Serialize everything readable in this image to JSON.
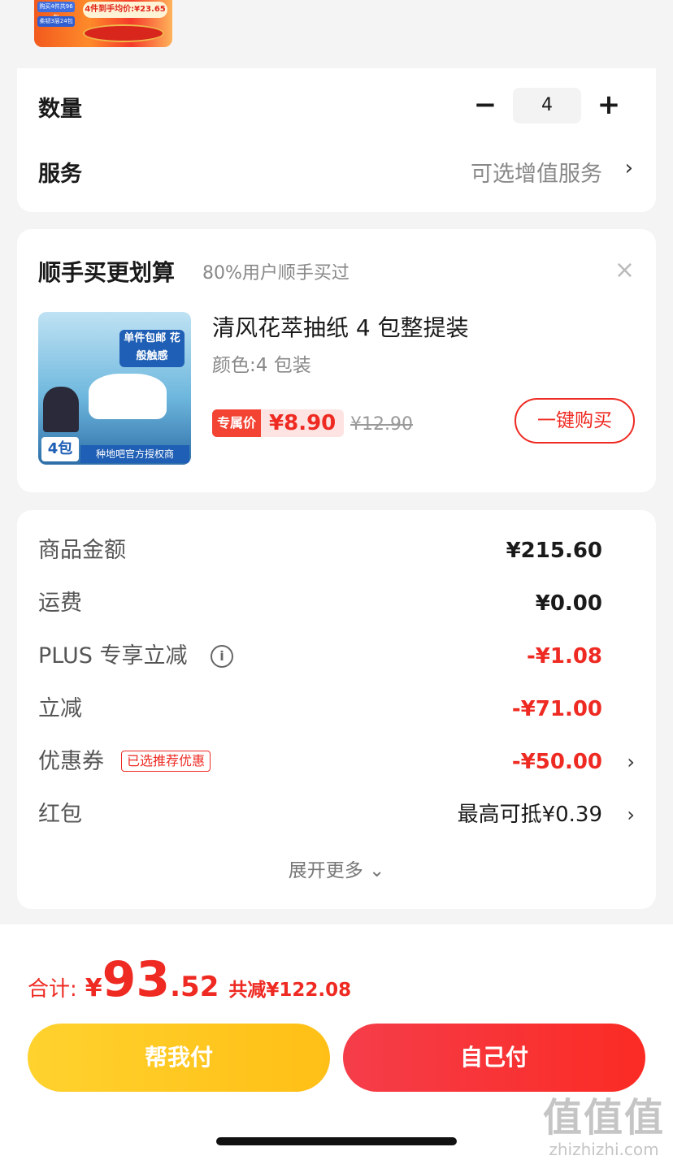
{
  "top_thumb": {
    "tag1": "购买4件共96包",
    "tag2": "柔韧3层24包",
    "promo": "4件到手均价:¥23.65"
  },
  "quantity": {
    "label": "数量",
    "value": "4",
    "minus": "−",
    "plus": "+"
  },
  "service": {
    "label": "服务",
    "value": "可选增值服务",
    "chevron": "›"
  },
  "addon": {
    "title": "顺手买更划算",
    "subtitle": "80%用户顺手买过",
    "close": "×",
    "product": {
      "image_badge": "单件包邮 花般触感",
      "image_count": "4包",
      "image_auth": "种地吧官方授权商",
      "name": "清风花萃抽纸 4 包整提装",
      "spec": "颜色:4 包装",
      "price_label": "专属价",
      "price": "¥8.90",
      "original_price": "¥12.90",
      "buy_label": "一键购买"
    }
  },
  "price_detail": {
    "rows": [
      {
        "label": "商品金额",
        "value": "¥215.60"
      },
      {
        "label": "运费",
        "value": "¥0.00"
      },
      {
        "label": "PLUS 专享立减",
        "value": "-¥1.08"
      },
      {
        "label": "立减",
        "value": "-¥71.00"
      },
      {
        "label": "优惠券",
        "tag": "已选推荐优惠",
        "value": "-¥50.00"
      },
      {
        "label": "红包",
        "value": "最高可抵¥0.39"
      }
    ],
    "info_icon": "i",
    "chevron": "›",
    "expand": "展开更多 ⌄"
  },
  "footer": {
    "total_label": "合计:",
    "total_yen": "¥",
    "total_int": "93",
    "total_dec": ".52",
    "saved": "共减¥122.08",
    "help_pay": "帮我付",
    "self_pay": "自己付"
  },
  "watermark": {
    "big": "值值值",
    "small": "zhizhizhi.com"
  },
  "colors": {
    "accent_red": "#ee2a22",
    "help_yellow": "#ffc61f",
    "background": "#f4f4f4"
  }
}
